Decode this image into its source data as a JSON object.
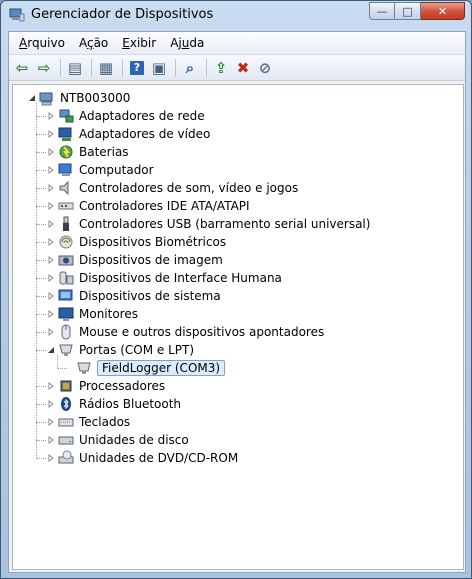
{
  "window": {
    "title": "Gerenciador de Dispositivos",
    "controls": {
      "minimize": "—",
      "maximize": "□",
      "close": "✕"
    }
  },
  "menu": [
    {
      "label": "Arquivo",
      "accel": "A"
    },
    {
      "label": "Ação",
      "accel": "ç"
    },
    {
      "label": "Exibir",
      "accel": "E"
    },
    {
      "label": "Ajuda",
      "accel": "u"
    }
  ],
  "toolbar": [
    {
      "name": "back-icon",
      "glyph": "⇦",
      "color": "#3f7d3a"
    },
    {
      "name": "forward-icon",
      "glyph": "⇨",
      "color": "#3f7d3a"
    },
    {
      "name": "sep"
    },
    {
      "name": "console-tree-icon",
      "glyph": "▤",
      "color": "#44607e"
    },
    {
      "name": "sep"
    },
    {
      "name": "properties-icon",
      "glyph": "▦",
      "color": "#44607e"
    },
    {
      "name": "sep"
    },
    {
      "name": "help-icon",
      "glyph": "?",
      "color": "#ffffff",
      "bg": "#2e64b3"
    },
    {
      "name": "action-pane-icon",
      "glyph": "▣",
      "color": "#44607e"
    },
    {
      "name": "sep"
    },
    {
      "name": "scan-hardware-icon",
      "glyph": "⌕",
      "color": "#2d5c9a"
    },
    {
      "name": "sep"
    },
    {
      "name": "update-driver-icon",
      "glyph": "⇪",
      "color": "#2a8a2a"
    },
    {
      "name": "uninstall-icon",
      "glyph": "✖",
      "color": "#c0281e"
    },
    {
      "name": "disable-icon",
      "glyph": "⊘",
      "color": "#5a6f8a"
    }
  ],
  "tree": {
    "root": {
      "label": "NTB003000",
      "icon": "computer-root-icon"
    },
    "items": [
      {
        "label": "Adaptadores de rede",
        "icon": "network-adapter-icon",
        "expanded": false
      },
      {
        "label": "Adaptadores de vídeo",
        "icon": "display-adapter-icon",
        "expanded": false
      },
      {
        "label": "Baterias",
        "icon": "battery-icon",
        "expanded": false
      },
      {
        "label": "Computador",
        "icon": "computer-icon",
        "expanded": false
      },
      {
        "label": "Controladores de som, vídeo e jogos",
        "icon": "speaker-icon",
        "expanded": false
      },
      {
        "label": "Controladores IDE ATA/ATAPI",
        "icon": "ide-controller-icon",
        "expanded": false
      },
      {
        "label": "Controladores USB (barramento serial universal)",
        "icon": "usb-icon",
        "expanded": false
      },
      {
        "label": "Dispositivos Biométricos",
        "icon": "fingerprint-icon",
        "expanded": false
      },
      {
        "label": "Dispositivos de imagem",
        "icon": "camera-icon",
        "expanded": false
      },
      {
        "label": "Dispositivos de Interface Humana",
        "icon": "hid-icon",
        "expanded": false
      },
      {
        "label": "Dispositivos de sistema",
        "icon": "system-device-icon",
        "expanded": false
      },
      {
        "label": "Monitores",
        "icon": "monitor-icon",
        "expanded": false
      },
      {
        "label": "Mouse e outros dispositivos apontadores",
        "icon": "mouse-icon",
        "expanded": false
      },
      {
        "label": "Portas (COM e LPT)",
        "icon": "port-icon",
        "expanded": true,
        "children": [
          {
            "label": "FieldLogger (COM3)",
            "icon": "port-device-icon",
            "selected": true
          }
        ]
      },
      {
        "label": "Processadores",
        "icon": "processor-icon",
        "expanded": false
      },
      {
        "label": "Rádios Bluetooth",
        "icon": "bluetooth-icon",
        "expanded": false
      },
      {
        "label": "Teclados",
        "icon": "keyboard-icon",
        "expanded": false
      },
      {
        "label": "Unidades de disco",
        "icon": "disk-drive-icon",
        "expanded": false
      },
      {
        "label": "Unidades de DVD/CD-ROM",
        "icon": "dvd-drive-icon",
        "expanded": false
      }
    ]
  }
}
